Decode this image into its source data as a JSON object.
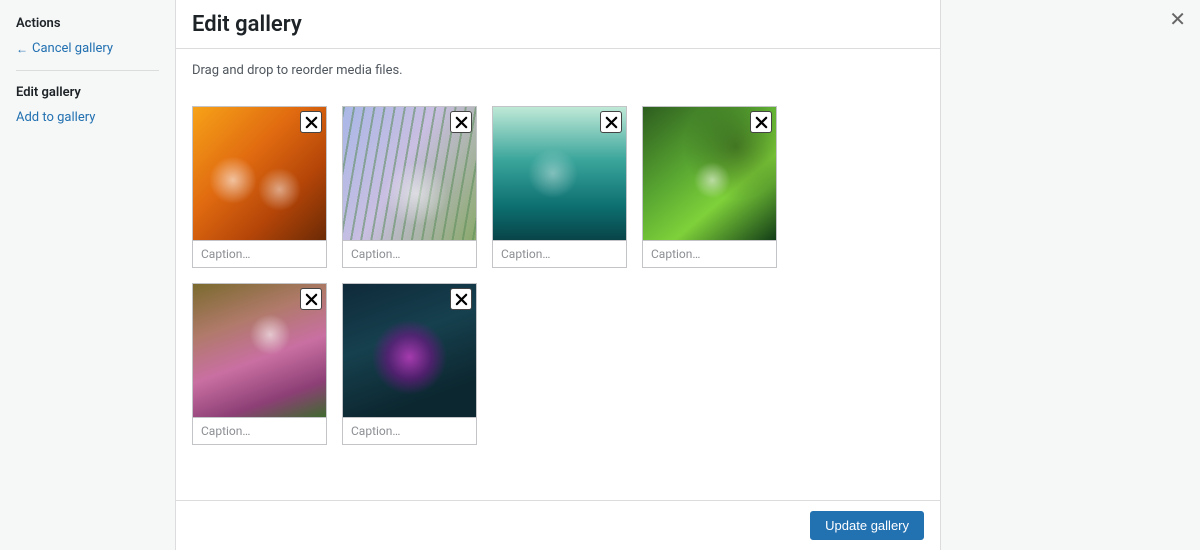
{
  "header": {
    "close_icon_label": "✕"
  },
  "sidebar": {
    "actions_heading": "Actions",
    "cancel_label": "Cancel gallery",
    "edit_heading": "Edit gallery",
    "add_label": "Add to gallery"
  },
  "main": {
    "title": "Edit gallery",
    "instructions": "Drag and drop to reorder media files.",
    "caption_placeholder": "Caption…",
    "items": [
      {
        "caption": ""
      },
      {
        "caption": ""
      },
      {
        "caption": ""
      },
      {
        "caption": ""
      },
      {
        "caption": ""
      },
      {
        "caption": ""
      }
    ]
  },
  "footer": {
    "update_label": "Update gallery"
  }
}
